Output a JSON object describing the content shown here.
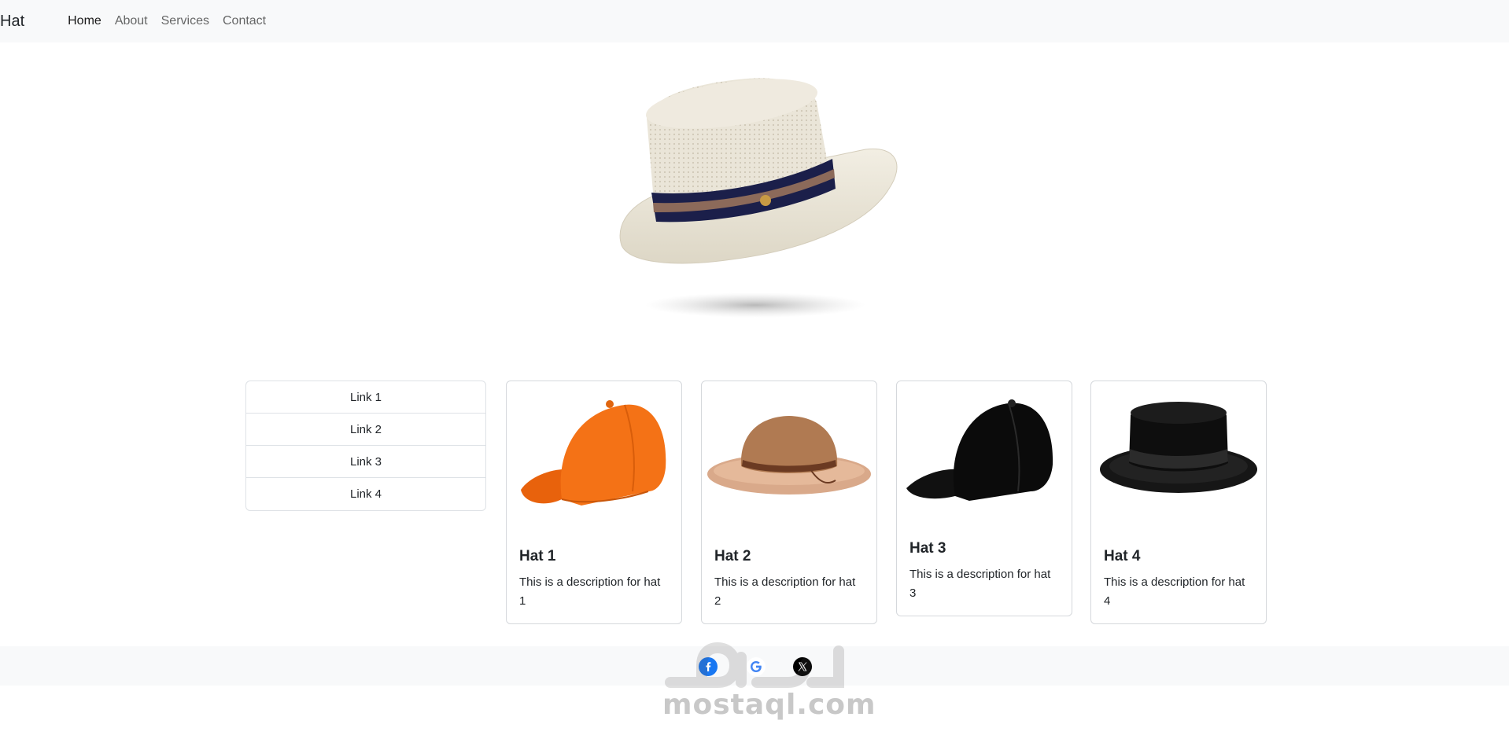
{
  "navbar": {
    "brand": "Hat",
    "links": [
      {
        "label": "Home",
        "active": true
      },
      {
        "label": "About",
        "active": false
      },
      {
        "label": "Services",
        "active": false
      },
      {
        "label": "Contact",
        "active": false
      }
    ]
  },
  "sidebar": {
    "links": [
      "Link 1",
      "Link 2",
      "Link 3",
      "Link 4"
    ]
  },
  "cards": [
    {
      "title": "Hat 1",
      "description": "This is a description for hat 1",
      "image": "orange-baseball-cap"
    },
    {
      "title": "Hat 2",
      "description": "This is a description for hat 2",
      "image": "straw-sun-hat"
    },
    {
      "title": "Hat 3",
      "description": "This is a description for hat 3",
      "image": "black-baseball-cap"
    },
    {
      "title": "Hat 4",
      "description": "This is a description for hat 4",
      "image": "black-top-hat"
    }
  ],
  "footer": {
    "icons": [
      "facebook-icon",
      "google-icon",
      "x-icon"
    ]
  },
  "watermark": {
    "arabic": "مستقل",
    "latin": "mostaql.com"
  },
  "colors": {
    "navbar_bg": "#f8f9fa",
    "footer_bg": "#f8f9fa",
    "border": "#dee2e6",
    "facebook": "#1877f2",
    "orange_cap": "#f47216"
  }
}
